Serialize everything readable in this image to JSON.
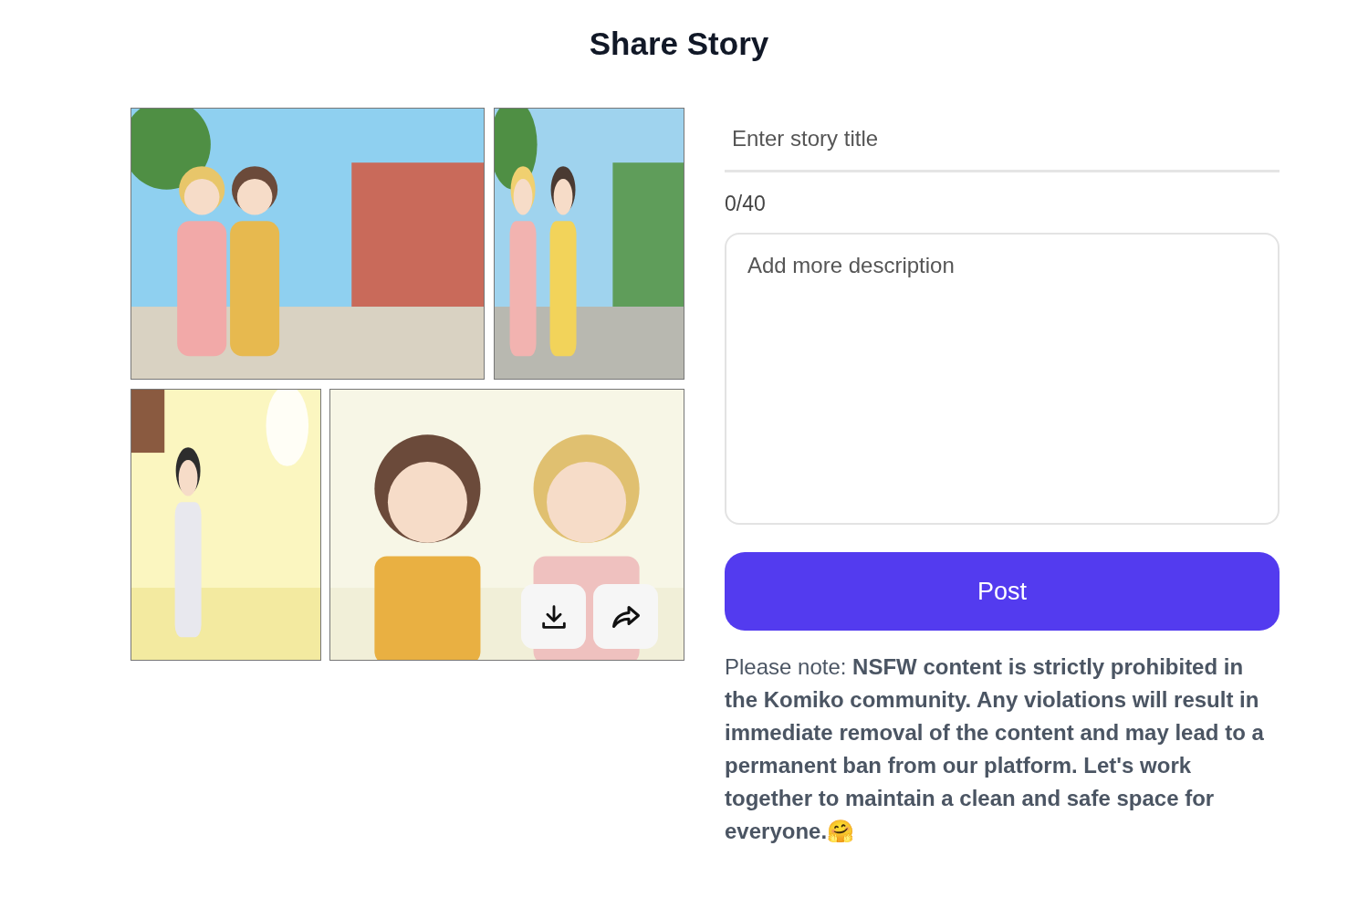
{
  "title": "Share Story",
  "story_title": {
    "placeholder": "Enter story title"
  },
  "char_count": "0/40",
  "description": {
    "placeholder": "Add more description"
  },
  "post_button": "Post",
  "note": "Please note: **NSFW content is strictly prohibited in the Komiko community. Any violations will result in immediate removal of the content and may lead to a permanent ban from our platform. Let's work together to maintain a clean and safe space for everyone.🤗**"
}
